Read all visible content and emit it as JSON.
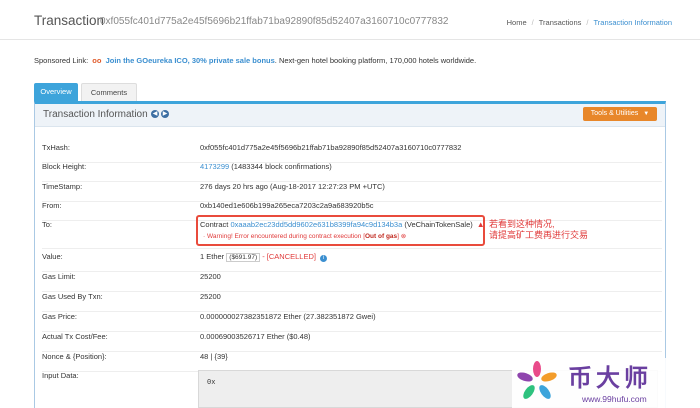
{
  "header": {
    "title": "Transaction",
    "hash": "0xf055fc401d775a2e45f5696b21ffab71ba92890f85d52407a3160710c0777832",
    "breadcrumb": [
      "Home",
      "Transactions",
      "Transaction Information"
    ]
  },
  "sponsored": {
    "prefix": "Sponsored Link:",
    "icon": "glasses-icon",
    "link": "Join the GOeureka ICO, 30% private sale bonus",
    "suffix": ". Next-gen hotel booking platform, 170,000 hotels worldwide."
  },
  "tabs": [
    {
      "label": "Overview",
      "active": true
    },
    {
      "label": "Comments",
      "active": false
    }
  ],
  "panel": {
    "title": "Transaction Information",
    "tools_label": "Tools & Utilities"
  },
  "rows": {
    "txhash": {
      "label": "TxHash:",
      "value": "0xf055fc401d775a2e45f5696b21ffab71ba92890f85d52407a3160710c0777832"
    },
    "block": {
      "label": "Block Height:",
      "link": "4173299",
      "suffix": " (1483344 block confirmations)"
    },
    "timestamp": {
      "label": "TimeStamp:",
      "value": "276 days 20 hrs ago (Aug-18-2017 12:27:23 PM +UTC)"
    },
    "from": {
      "label": "From:",
      "link": "0xb140ed1e606b199a265eca7203c2a9a683920b5c"
    },
    "to": {
      "label": "To:",
      "prefix": "Contract ",
      "link": "0xaaab2ec23dd5dd9602e631b8399fa94c9d134b3a",
      "suffix": " (VeChainTokenSale)",
      "warning_prefix": "Warning! Error encountered during contract execution [",
      "warning_bold": "Out of gas",
      "warning_suffix": "]"
    },
    "value": {
      "label": "Value:",
      "amount": "1 Ether",
      "price": "($691.97)",
      "status": " - [CANCELLED]"
    },
    "gas_limit": {
      "label": "Gas Limit:",
      "value": "25200"
    },
    "gas_used": {
      "label": "Gas Used By Txn:",
      "value": "25200"
    },
    "gas_price": {
      "label": "Gas Price:",
      "value": "0.000000027382351872 Ether (27.382351872 Gwei)"
    },
    "tx_cost": {
      "label": "Actual Tx Cost/Fee:",
      "value": "0.00069003526717 Ether ($0.48)"
    },
    "nonce": {
      "label": "Nonce & {Position}:",
      "value": "48 | {39}"
    },
    "input": {
      "label": "Input Data:",
      "value": "0x"
    }
  },
  "annotation": {
    "line1": "若看到这种情况,",
    "line2": "请提高矿工费再进行交易"
  },
  "watermark": {
    "text": "币大师",
    "url": "www.99hufu.com"
  },
  "colors": {
    "accent": "#3da4db",
    "link": "#3b8fd0",
    "tools_button": "#e8872a",
    "error": "#e03a3a",
    "watermark": "#6a3fa0"
  }
}
